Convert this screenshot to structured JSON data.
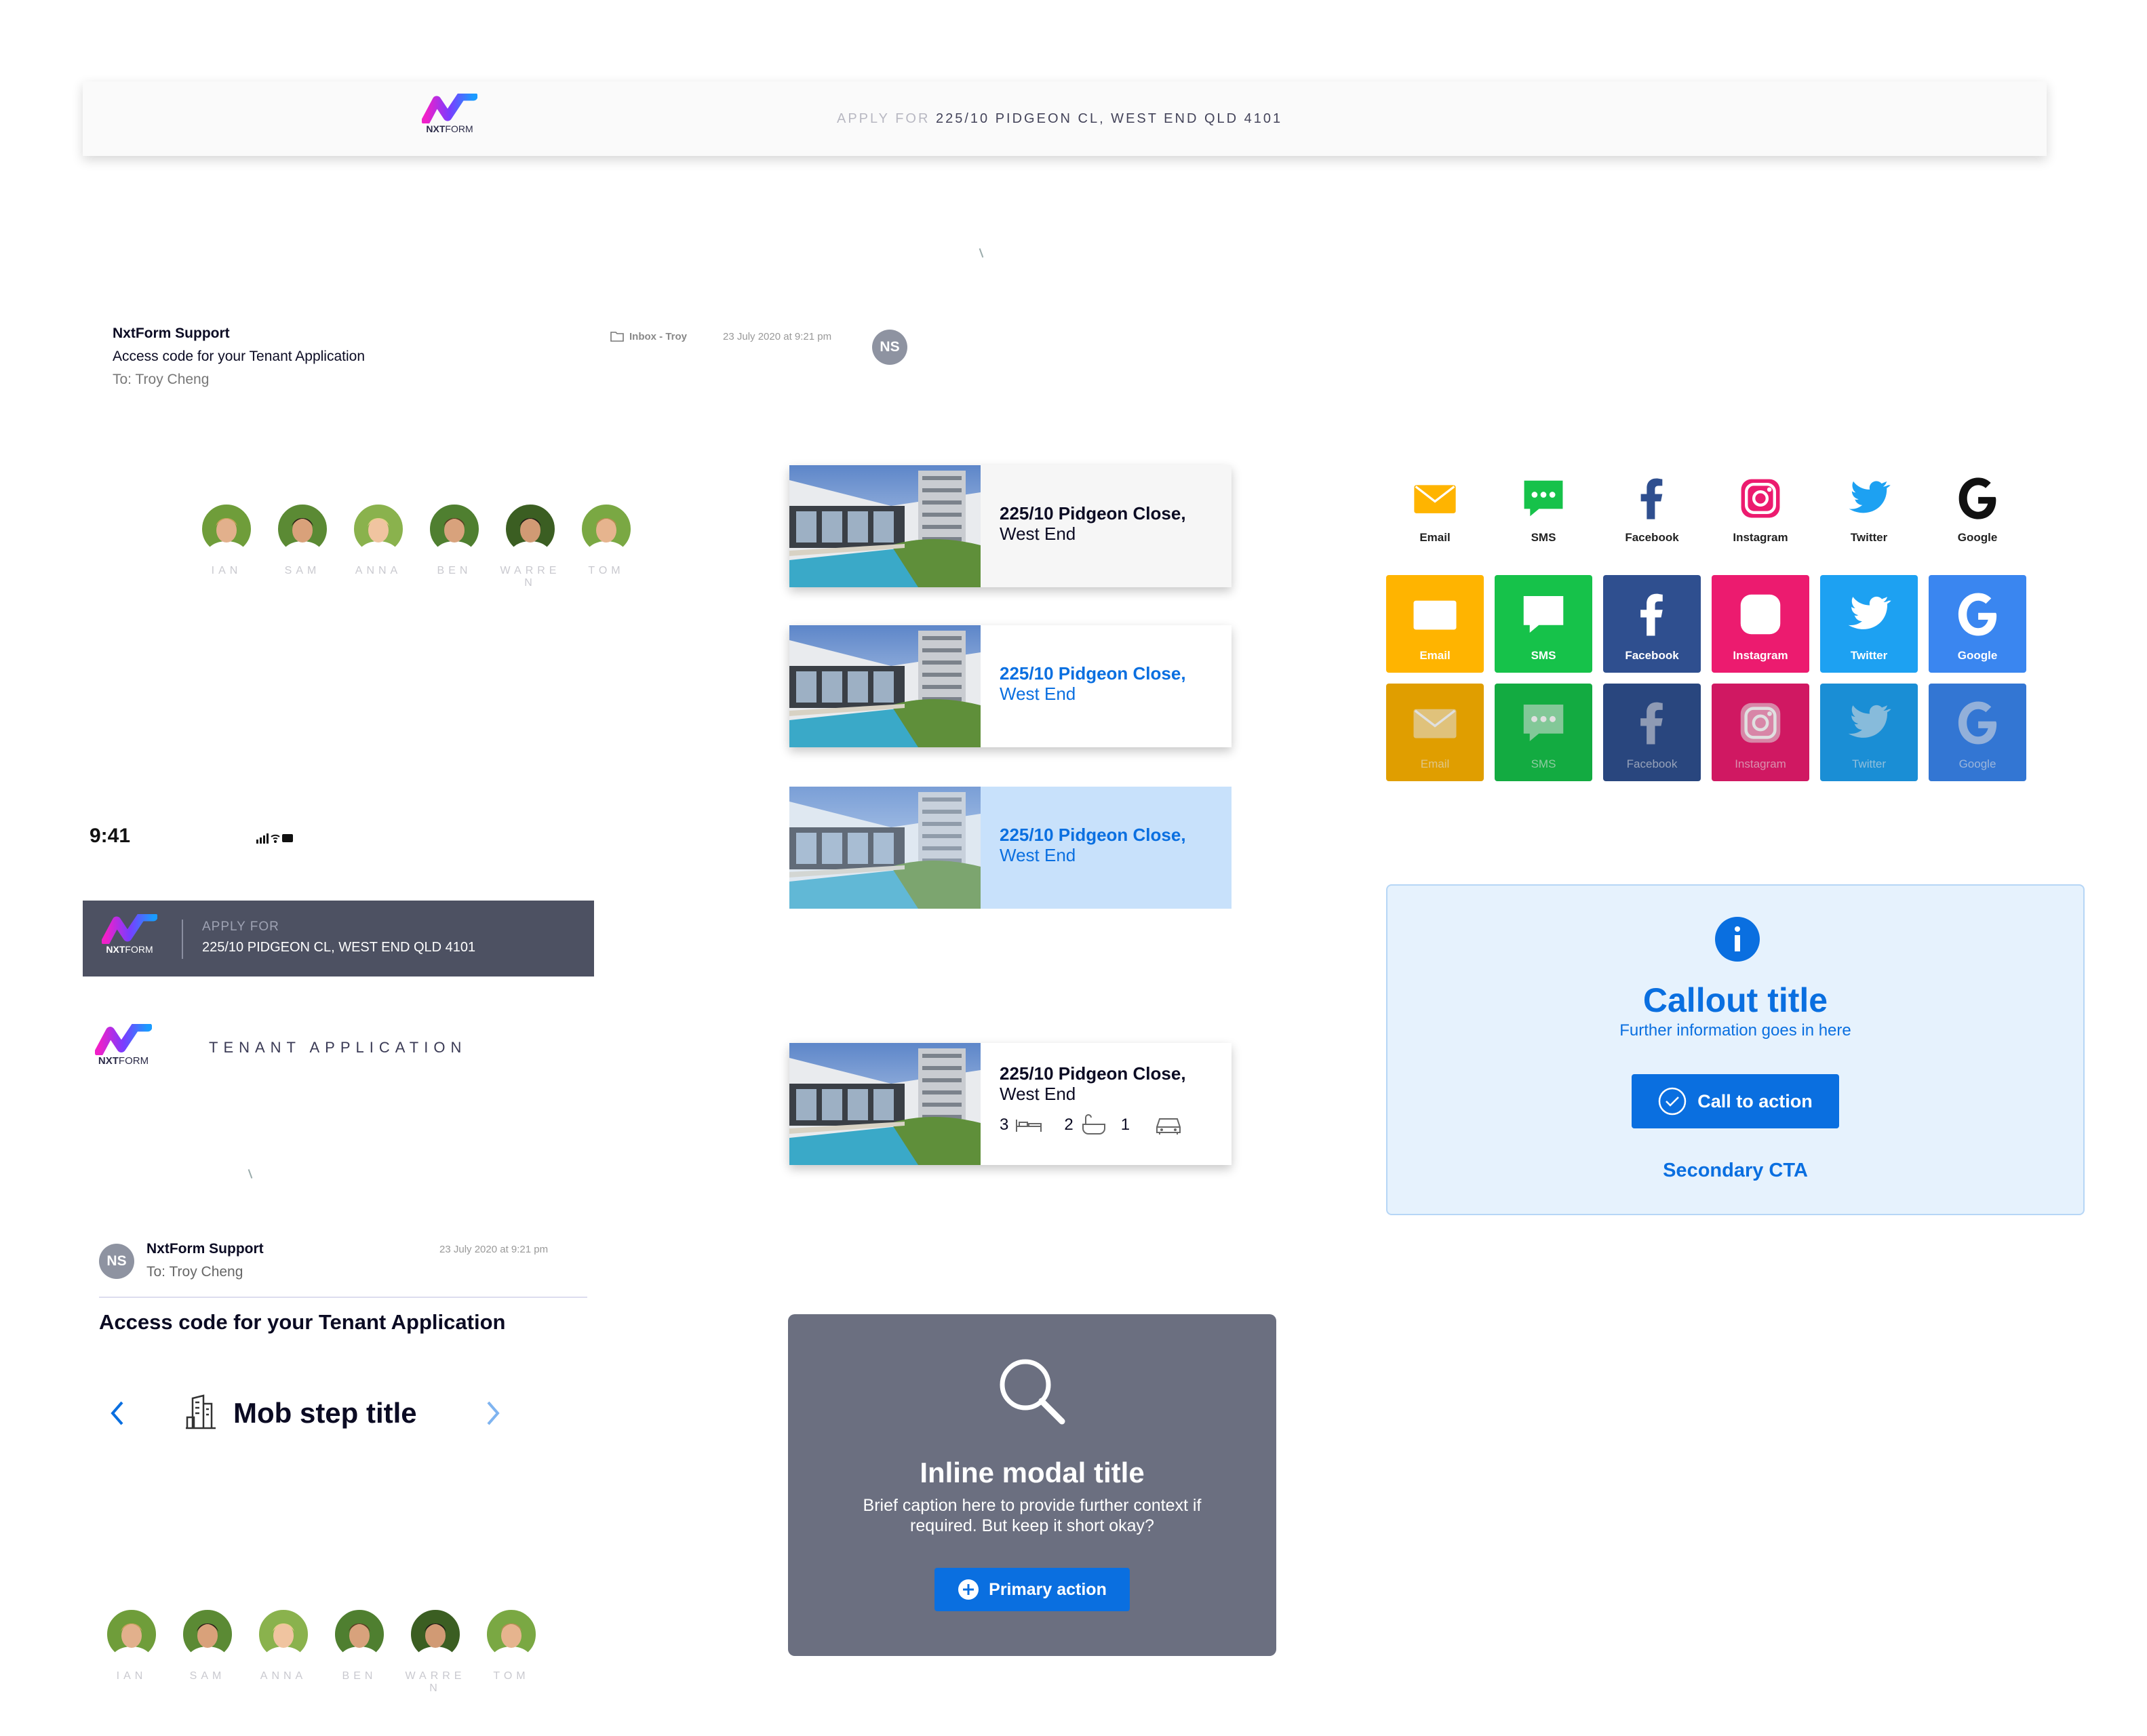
{
  "topbar": {
    "apply_prefix": "APPLY FOR",
    "address": "225/10 PIDGEON CL, WEST END QLD 4101"
  },
  "logo": {
    "bold": "NXT",
    "thin": "FORM"
  },
  "email_desktop": {
    "sender": "NxtForm Support",
    "subject": "Access code for your Tenant Application",
    "to": "To: Troy Cheng",
    "folder": "Inbox - Troy",
    "date": "23 July 2020 at 9:21 pm",
    "initials": "NS"
  },
  "team": [
    {
      "name": "IAN",
      "skin": "#e2b08c",
      "hair": "#c9a15a",
      "bg": "#6f9d3a"
    },
    {
      "name": "SAM",
      "skin": "#d9a17a",
      "hair": "#2a2018",
      "bg": "#5b8a34"
    },
    {
      "name": "ANNA",
      "skin": "#f0c4a0",
      "hair": "#e8cf8a",
      "bg": "#8ab24d"
    },
    {
      "name": "BEN",
      "skin": "#d8a27c",
      "hair": "#5a3c22",
      "bg": "#4f7f30"
    },
    {
      "name": "WARREN",
      "skin": "#d19a74",
      "hair": "#1f1a16",
      "bg": "#3b5e22"
    },
    {
      "name": "TOM",
      "skin": "#e6b48e",
      "hair": "#b88d52",
      "bg": "#7aa843"
    }
  ],
  "property": {
    "line1": "225/10 Pidgeon Close,",
    "line2": "West End",
    "beds": "3",
    "baths": "2",
    "cars": "1"
  },
  "share": [
    {
      "name": "Email",
      "icon": "envelope-icon",
      "color": "#ffb400"
    },
    {
      "name": "SMS",
      "icon": "chat-icon",
      "color": "#16c24a"
    },
    {
      "name": "Facebook",
      "icon": "facebook-icon",
      "color": "#2f4f8f"
    },
    {
      "name": "Instagram",
      "icon": "instagram-icon",
      "color": "#ec1b6f"
    },
    {
      "name": "Twitter",
      "icon": "twitter-icon",
      "color": "#1da1f2"
    },
    {
      "name": "Google",
      "icon": "google-icon",
      "color": "#3a86f0"
    }
  ],
  "mobile": {
    "time": "9:41",
    "header_apply": "APPLY FOR",
    "header_address": "225/10 PIDGEON CL, WEST END QLD 4101",
    "tenant_application": "TENANT APPLICATION",
    "email_sender": "NxtForm Support",
    "email_to": "To: Troy Cheng",
    "email_date": "23 July 2020 at 9:21 pm",
    "email_initials": "NS",
    "email_subject": "Access code for your Tenant Application",
    "step_title": "Mob step title"
  },
  "callout": {
    "title": "Callout title",
    "subtitle": "Further information goes in here",
    "cta": "Call to action",
    "secondary": "Secondary CTA",
    "accent": "#0a6fe0"
  },
  "modal": {
    "title": "Inline modal title",
    "caption1": "Brief caption here to provide further context if",
    "caption2": "required. But keep it short okay?",
    "action": "Primary action",
    "bg": "#6b6f80"
  }
}
